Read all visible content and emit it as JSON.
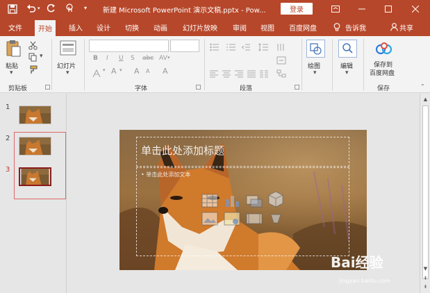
{
  "titlebar": {
    "title": "新建 Microsoft PowerPoint 演示文稿.pptx  -  Pow...",
    "login_label": "登录",
    "save_icon": "save-icon",
    "undo_icon": "undo-icon",
    "redo_icon": "redo-icon",
    "touch_icon": "touch-mode-icon"
  },
  "tabs": [
    {
      "label": "文件"
    },
    {
      "label": "开始"
    },
    {
      "label": "插入"
    },
    {
      "label": "设计"
    },
    {
      "label": "切换"
    },
    {
      "label": "动画"
    },
    {
      "label": "幻灯片放映"
    },
    {
      "label": "审阅"
    },
    {
      "label": "视图"
    },
    {
      "label": "百度网盘"
    },
    {
      "label": "告诉我"
    },
    {
      "label": "共享"
    }
  ],
  "ribbon": {
    "paste_label": "粘贴",
    "clipboard_label": "剪贴板",
    "slides_label": "幻灯片",
    "font_label": "字体",
    "paragraph_label": "段落",
    "draw_label": "绘图",
    "edit_label": "编辑",
    "save_to_label_1": "保存到",
    "save_to_label_2": "百度网盘",
    "save_group_label": "保存",
    "bold": "B",
    "italic": "I",
    "underline": "U",
    "strike": "S",
    "spacing": "abc",
    "charspace": "AV",
    "fontcolor": "A",
    "grow": "A",
    "shrink": "A",
    "clear": "A"
  },
  "slides": [
    {
      "number": "1"
    },
    {
      "number": "2"
    },
    {
      "number": "3"
    }
  ],
  "slide": {
    "title_placeholder": "单击此处添加标题",
    "body_placeholder": "• 单击此处添加文本"
  },
  "watermark": {
    "brand": "Bai经验",
    "url": "jingyan.baidu.com"
  },
  "colors": {
    "accent": "#b7472a",
    "ribbon_bg": "#f3f3f3"
  }
}
